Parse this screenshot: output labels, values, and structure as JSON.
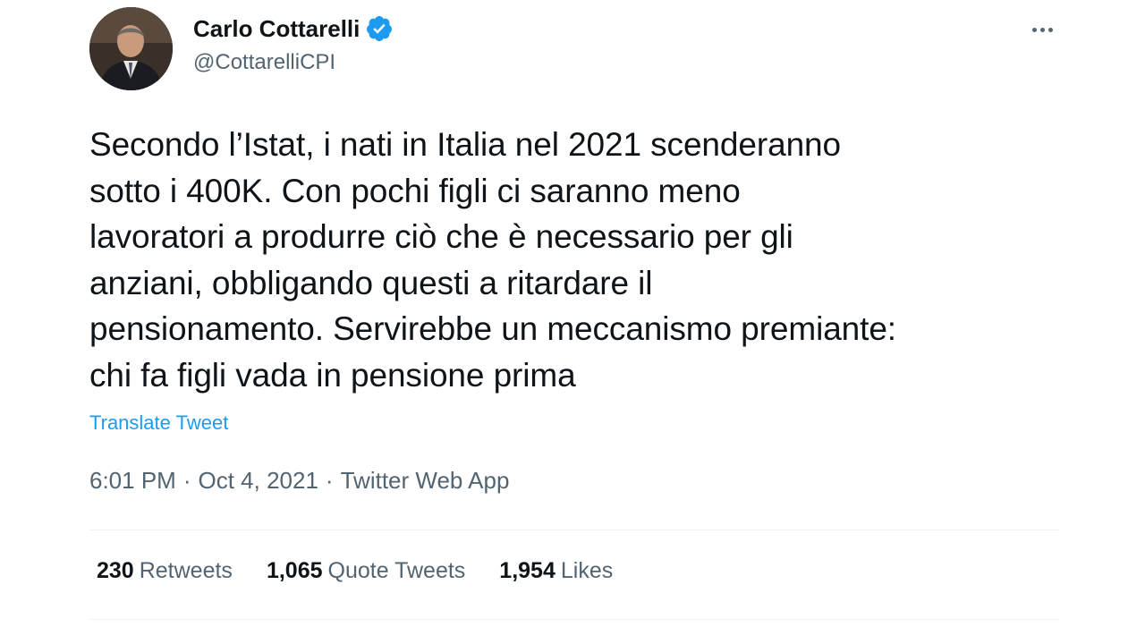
{
  "author": {
    "display_name": "Carlo Cottarelli",
    "handle": "@CottarelliCPI",
    "verified_icon": "verified-badge-icon"
  },
  "tweet": {
    "text": "Secondo l’Istat, i nati in Italia nel 2021 scenderanno\nsotto i 400K. Con pochi figli ci saranno meno\nlavoratori a produrre ciò che è necessario per gli\nanziani, obbligando questi a ritardare il\npensionamento. Servirebbe un meccanismo premiante:\nchi fa figli vada in pensione prima",
    "translate_label": "Translate Tweet",
    "time": "6:01 PM",
    "date": "Oct 4, 2021",
    "separator": "·",
    "source": "Twitter Web App"
  },
  "stats": {
    "retweets_count": "230",
    "retweets_label": "Retweets",
    "quote_count": "1,065",
    "quote_label": "Quote Tweets",
    "likes_count": "1,954",
    "likes_label": "Likes"
  },
  "colors": {
    "accent": "#1d9bf0",
    "text_primary": "#0f1419",
    "text_secondary": "#536471",
    "divider": "#eff3f4"
  }
}
